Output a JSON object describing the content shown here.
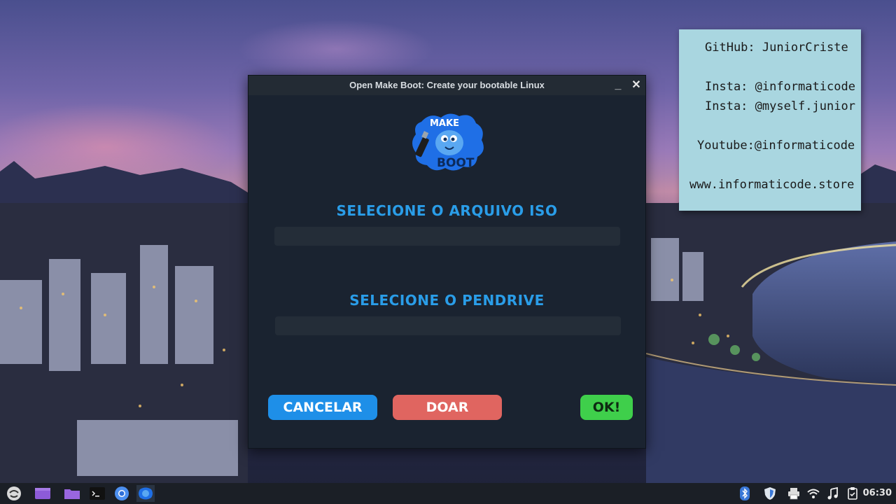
{
  "sticky_note": {
    "lines": [
      "GitHub: JuniorCriste",
      "Insta: @informaticode",
      "Insta: @myself.junior",
      "Youtube:@informaticode",
      "www.informaticode.store"
    ]
  },
  "window": {
    "title": "Open Make Boot: Create your bootable Linux",
    "minimize_glyph": "_",
    "close_glyph": "✕",
    "logo": {
      "top_text": "MAKE",
      "bottom_text": "BOOT",
      "icon": "usb-drive-mascot-logo"
    },
    "iso_section": {
      "label": "SELECIONE O ARQUIVO ISO",
      "value": ""
    },
    "pendrive_section": {
      "label": "SELECIONE O PENDRIVE",
      "value": ""
    },
    "buttons": {
      "cancel": "CANCELAR",
      "donate": "DOAR",
      "ok": "OK!"
    }
  },
  "taskbar": {
    "launchers": [
      "app-menu-icon",
      "workspace-icon",
      "file-manager-icon",
      "terminal-icon",
      "chromium-icon",
      "make-boot-icon"
    ],
    "tray": [
      "bluetooth-icon",
      "shield-icon",
      "printer-icon",
      "wifi-icon",
      "music-icon",
      "clipboard-icon"
    ],
    "clock": "06:30"
  },
  "colors": {
    "accent_blue": "#2a9de8",
    "cancel_button": "#1e8fe8",
    "donate_button": "#e06560",
    "ok_button": "#3fcf4b",
    "window_bg": "#1a2330"
  }
}
